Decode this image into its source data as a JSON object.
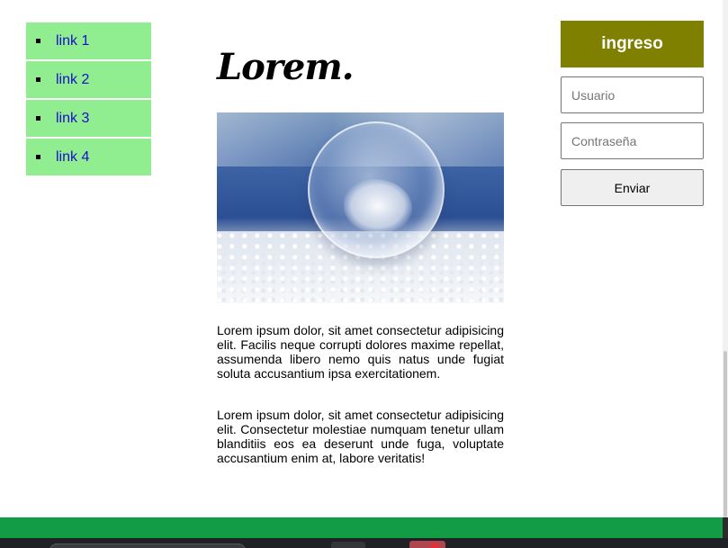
{
  "nav": {
    "items": [
      {
        "label": "link 1"
      },
      {
        "label": "link 2"
      },
      {
        "label": "link 3"
      },
      {
        "label": "link 4"
      }
    ]
  },
  "main": {
    "title": "Lorem.",
    "paragraphs": [
      "Lorem ipsum dolor, sit amet consectetur adipisicing elit. Facilis neque corrupti dolores maxime repellat, assumenda libero nemo quis natus unde fugiat soluta accusantium ipsa exercitationem.",
      "Lorem ipsum dolor, sit amet consectetur adipisicing elit. Consectetur molestiae numquam tenetur ullam blanditiis eos ea deserunt unde fuga, voluptate accusantium enim at, labore veritatis!"
    ]
  },
  "login": {
    "title": "ingreso",
    "username_placeholder": "Usuario",
    "username_value": "",
    "password_placeholder": "Contraseña",
    "password_value": "",
    "submit_label": "Enviar"
  },
  "colors": {
    "nav_background": "#90ee90",
    "link": "#1a0dcc",
    "login_header": "#808000",
    "footer": "#119c45"
  }
}
